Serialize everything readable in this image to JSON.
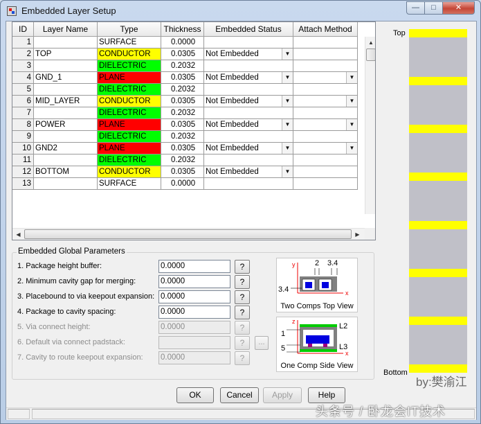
{
  "window": {
    "title": "Embedded Layer Setup",
    "min_glyph": "—",
    "max_glyph": "□",
    "close_glyph": "✕"
  },
  "grid": {
    "headers": [
      "ID",
      "Layer Name",
      "Type",
      "Thickness",
      "Embedded Status",
      "Attach Method"
    ],
    "type_colors": {
      "SURFACE": "#ffffff",
      "CONDUCTOR": "#ffff00",
      "DIELECTRIC": "#00ff00",
      "PLANE": "#ff0000"
    },
    "rows": [
      {
        "id": "1",
        "name": "",
        "type": "SURFACE",
        "thickness": "0.0000",
        "status": "",
        "attach_combo": false
      },
      {
        "id": "2",
        "name": "TOP",
        "type": "CONDUCTOR",
        "thickness": "0.0305",
        "status": "Not Embedded",
        "attach_combo": false
      },
      {
        "id": "3",
        "name": "",
        "type": "DIELECTRIC",
        "thickness": "0.2032",
        "status": "",
        "attach_combo": false
      },
      {
        "id": "4",
        "name": "GND_1",
        "type": "PLANE",
        "thickness": "0.0305",
        "status": "Not Embedded",
        "attach_combo": true
      },
      {
        "id": "5",
        "name": "",
        "type": "DIELECTRIC",
        "thickness": "0.2032",
        "status": "",
        "attach_combo": false
      },
      {
        "id": "6",
        "name": "MID_LAYER",
        "type": "CONDUCTOR",
        "thickness": "0.0305",
        "status": "Not Embedded",
        "attach_combo": true
      },
      {
        "id": "7",
        "name": "",
        "type": "DIELECTRIC",
        "thickness": "0.2032",
        "status": "",
        "attach_combo": false
      },
      {
        "id": "8",
        "name": "POWER",
        "type": "PLANE",
        "thickness": "0.0305",
        "status": "Not Embedded",
        "attach_combo": true
      },
      {
        "id": "9",
        "name": "",
        "type": "DIELECTRIC",
        "thickness": "0.2032",
        "status": "",
        "attach_combo": false
      },
      {
        "id": "10",
        "name": "GND2",
        "type": "PLANE",
        "thickness": "0.0305",
        "status": "Not Embedded",
        "attach_combo": true
      },
      {
        "id": "11",
        "name": "",
        "type": "DIELECTRIC",
        "thickness": "0.2032",
        "status": "",
        "attach_combo": false
      },
      {
        "id": "12",
        "name": "BOTTOM",
        "type": "CONDUCTOR",
        "thickness": "0.0305",
        "status": "Not Embedded",
        "attach_combo": false
      },
      {
        "id": "13",
        "name": "",
        "type": "SURFACE",
        "thickness": "0.0000",
        "status": "",
        "attach_combo": false
      }
    ]
  },
  "params": {
    "group_title": "Embedded Global Parameters",
    "items": [
      {
        "label": "1. Package height buffer:",
        "value": "0.0000",
        "enabled": true
      },
      {
        "label": "2. Minimum cavity gap for merging:",
        "value": "0.0000",
        "enabled": true
      },
      {
        "label": "3. Placebound to via keepout expansion:",
        "value": "0.0000",
        "enabled": true
      },
      {
        "label": "4. Package to cavity spacing:",
        "value": "0.0000",
        "enabled": true
      },
      {
        "label": "5. Via connect height:",
        "value": "0.0000",
        "enabled": false
      },
      {
        "label": "6. Default via connect padstack:",
        "value": "",
        "enabled": false
      },
      {
        "label": "7. Cavity to route keepout expansion:",
        "value": "0.0000",
        "enabled": false
      }
    ],
    "help_glyph": "?",
    "browse_glyph": "..."
  },
  "diagram_top": {
    "caption": "Two Comps Top View",
    "axis_y": "y",
    "axis_x": "x",
    "dim_gap": "2",
    "dim_edge": "3.4",
    "dim_side": "3.4"
  },
  "diagram_side": {
    "caption": "One Comp Side View",
    "axis_z": "z",
    "axis_x": "x",
    "layer_top": "L2",
    "layer_bottom": "L3",
    "dim_top": "1",
    "dim_bottom": "5"
  },
  "buttons": {
    "ok": "OK",
    "cancel": "Cancel",
    "apply": "Apply",
    "help": "Help"
  },
  "stack": {
    "top_label": "Top",
    "bottom_label": "Bottom",
    "layers_shown": 8,
    "bar_color": "#ffff00",
    "body_color": "#c0c0c8"
  },
  "watermark": {
    "by": "by:樊渝江",
    "site": "头条号 / 卧龙会IT技术"
  }
}
